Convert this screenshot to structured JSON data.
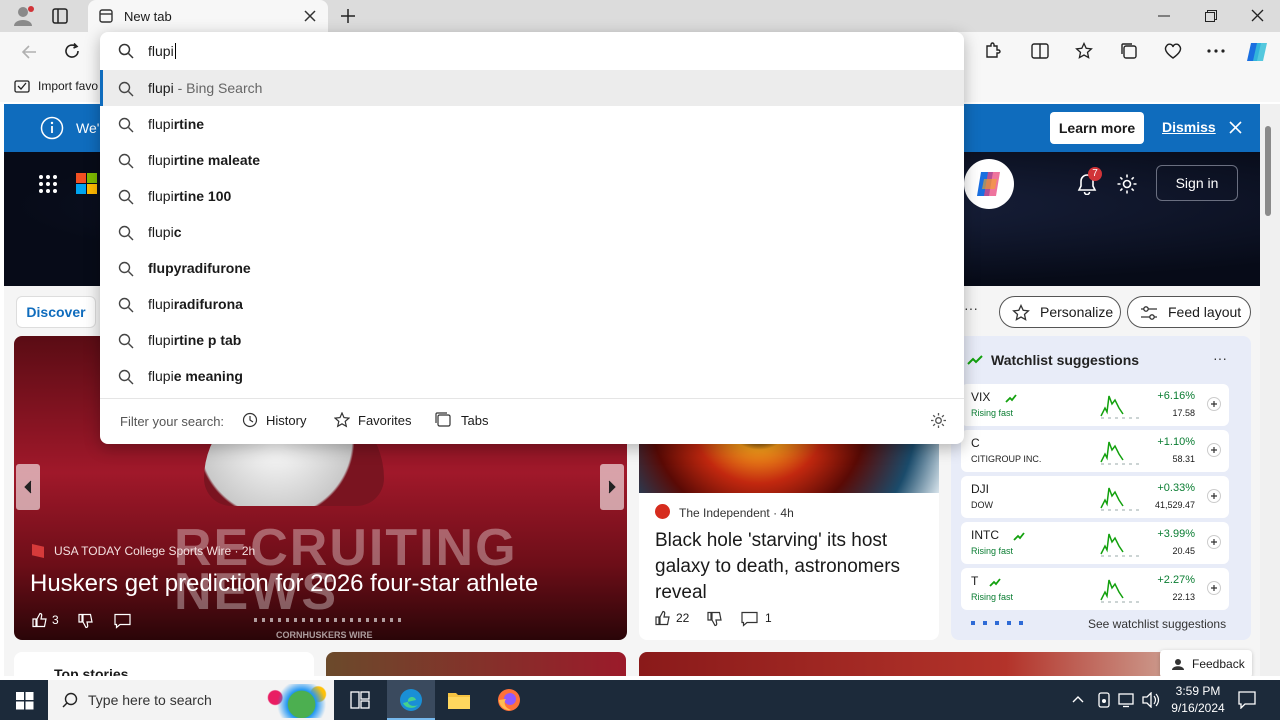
{
  "browser": {
    "tab_title": "New tab",
    "address_value": "flupi",
    "favorites_label": "Import favo"
  },
  "omnibox": {
    "suggestions": [
      {
        "typed": "flupi",
        "rest": " - Bing Search",
        "rest_style": "muted"
      },
      {
        "typed": "flupi",
        "rest": "rtine",
        "rest_style": "bold"
      },
      {
        "typed": "flupi",
        "rest": "rtine maleate",
        "rest_style": "bold"
      },
      {
        "typed": "flupi",
        "rest": "rtine 100",
        "rest_style": "bold"
      },
      {
        "typed": "flupi",
        "rest": "c",
        "rest_style": "bold"
      },
      {
        "typed": "",
        "rest": "flupyradifurone",
        "rest_style": "bold"
      },
      {
        "typed": "flupi",
        "rest": "radifurona",
        "rest_style": "bold"
      },
      {
        "typed": "flupi",
        "rest": "rtine p tab",
        "rest_style": "bold"
      },
      {
        "typed": "flupi",
        "rest": "e meaning",
        "rest_style": "bold"
      }
    ],
    "filter_label": "Filter your search:",
    "filter_history": "History",
    "filter_favorites": "Favorites",
    "filter_tabs": "Tabs"
  },
  "banner": {
    "text": "We'",
    "learn_more": "Learn more",
    "dismiss": "Dismiss"
  },
  "header": {
    "notification_count": "7",
    "sign_in": "Sign in"
  },
  "feed": {
    "discover": "Discover",
    "personalize": "Personalize",
    "feed_layout": "Feed layout",
    "hero_source": "USA TODAY College Sports Wire · 2h",
    "hero_headline": "Huskers get prediction for 2026 four-star athlete",
    "hero_likes": "3",
    "hero_image_text": "RECRUITING NEWS",
    "hero_image_sub": "CORNHUSKERS WIRE",
    "card2_source": "The Independent · 4h",
    "card2_headline": "Black hole 'starving' its host galaxy to death, astronomers reveal",
    "card2_likes": "22",
    "card2_comments": "1",
    "top_stories": "Top stories"
  },
  "watchlist": {
    "title": "Watchlist suggestions",
    "see_more": "See watchlist suggestions",
    "stocks": [
      {
        "symbol": "VIX",
        "sub": "Rising fast",
        "change": "+6.16%",
        "price": "17.58",
        "rising": true
      },
      {
        "symbol": "C",
        "sub": "CITIGROUP INC.",
        "change": "+1.10%",
        "price": "58.31",
        "rising": false
      },
      {
        "symbol": "DJI",
        "sub": "DOW",
        "change": "+0.33%",
        "price": "41,529.47",
        "rising": false
      },
      {
        "symbol": "INTC",
        "sub": "Rising fast",
        "change": "+3.99%",
        "price": "20.45",
        "rising": true
      },
      {
        "symbol": "T",
        "sub": "Rising fast",
        "change": "+2.27%",
        "price": "22.13",
        "rising": true
      }
    ],
    "colors": {
      "up": "#0a7d32",
      "sub": "#0a7d32"
    }
  },
  "feedback": "Feedback",
  "taskbar": {
    "search_placeholder": "Type here to search",
    "time": "3:59 PM",
    "date": "9/16/2024"
  }
}
